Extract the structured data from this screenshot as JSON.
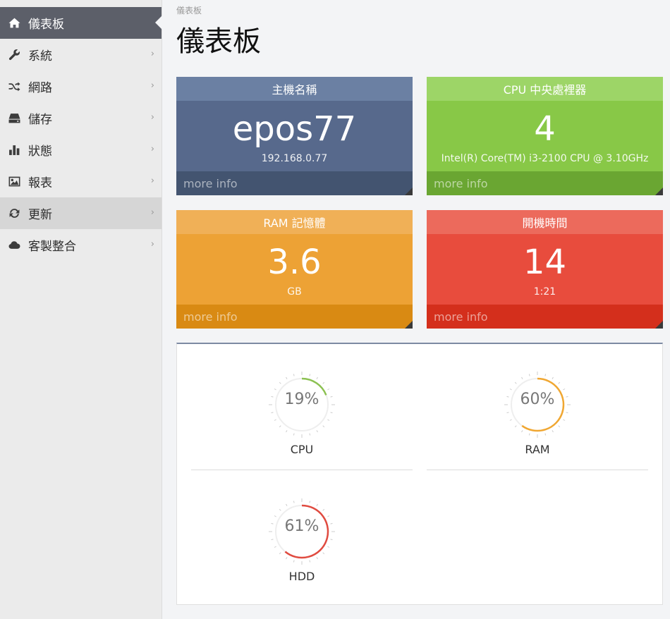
{
  "sidebar": {
    "items": [
      {
        "label": "儀表板",
        "icon": "home-icon",
        "active": true
      },
      {
        "label": "系統",
        "icon": "wrench-icon"
      },
      {
        "label": "網路",
        "icon": "shuffle-icon"
      },
      {
        "label": "儲存",
        "icon": "hdd-icon"
      },
      {
        "label": "狀態",
        "icon": "bar-chart-icon"
      },
      {
        "label": "報表",
        "icon": "picture-icon"
      },
      {
        "label": "更新",
        "icon": "refresh-icon"
      },
      {
        "label": "客製整合",
        "icon": "cloud-icon"
      }
    ]
  },
  "breadcrumb": "儀表板",
  "page_title": "儀表板",
  "boxes": {
    "host": {
      "title": "主機名稱",
      "value": "epos77",
      "sub": "192.168.0.77",
      "more": "more info",
      "color": "#57698c"
    },
    "cpu": {
      "title": "CPU 中央處裡器",
      "value": "4",
      "sub": "Intel(R) Core(TM) i3-2100 CPU @ 3.10GHz",
      "more": "more info",
      "color": "#88c847"
    },
    "ram": {
      "title": "RAM 記憶體",
      "value": "3.6",
      "sub": "GB",
      "more": "more info",
      "color": "#eda235"
    },
    "uptime": {
      "title": "開機時間",
      "value": "14",
      "sub": "1:21",
      "more": "more info",
      "color": "#e84c3d"
    }
  },
  "gauges": [
    {
      "label": "CPU",
      "percent_text": "19%",
      "percent": 19,
      "color": "#8cc152"
    },
    {
      "label": "RAM",
      "percent_text": "60%",
      "percent": 60,
      "color": "#f0a732"
    },
    {
      "label": "HDD",
      "percent_text": "61%",
      "percent": 61,
      "color": "#e04b40"
    }
  ]
}
